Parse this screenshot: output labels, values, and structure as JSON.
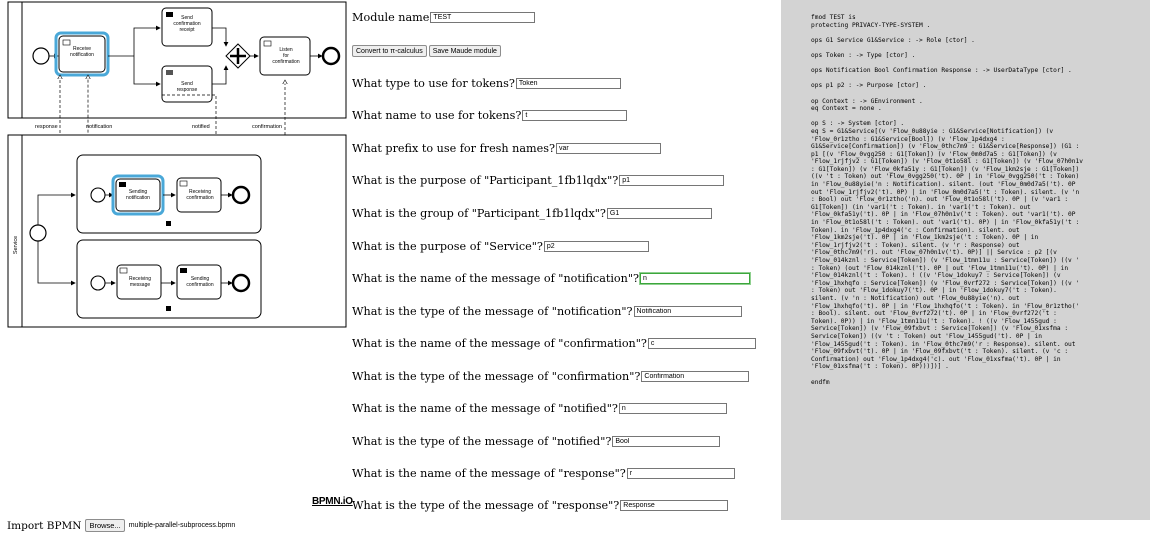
{
  "diagram": {
    "tasks": {
      "receive_notification": "Receive notification",
      "send_confirmation_receipt": "Send confirmation receipt",
      "send_response": "Send response",
      "listen_for_confirmation": "Listen for confirmation",
      "sending_notification": "Sending notification",
      "receiving_confirmation": "Receiving confirmation",
      "receiving_message": "Receiving message",
      "sending_confirmation": "Sending confirmation"
    },
    "lane_label": "Service",
    "edge_labels": {
      "response": "response",
      "notification": "notification",
      "notified": "notified",
      "confirmation": "confirmation"
    },
    "logo": "BPMN.iO"
  },
  "form": {
    "module_name_label": "Module name",
    "module_name_value": "TEST",
    "buttons": {
      "convert": "Convert to π-calculus",
      "save": "Save Maude module"
    },
    "fields": [
      {
        "label": "What type to use for tokens?",
        "value": "Token",
        "width": 105
      },
      {
        "label": "What name to use for tokens?",
        "value": "t",
        "width": 105
      },
      {
        "label": "What prefix to use for fresh names?",
        "value": "var",
        "width": 105
      },
      {
        "label": "What is the purpose of \"Participant_1fb1lqdx\"?",
        "value": "p1",
        "width": 105
      },
      {
        "label": "What is the group of \"Participant_1fb1lqdx\"?",
        "value": "G1",
        "width": 105
      },
      {
        "label": "What is the purpose of \"Service\"?",
        "value": "p2",
        "width": 105
      },
      {
        "label": "What is the name of the message of \"notification\"?",
        "value": "n",
        "width": 110,
        "focused": true
      },
      {
        "label": "What is the type of the message of \"notification\"?",
        "value": "Notification",
        "width": 108
      },
      {
        "label": "What is the name of the message of \"confirmation\"?",
        "value": "c",
        "width": 108
      },
      {
        "label": "What is the type of the message of \"confirmation\"?",
        "value": "Confirmation",
        "width": 108
      },
      {
        "label": "What is the name of the message of \"notified\"?",
        "value": "n",
        "width": 108
      },
      {
        "label": "What is the type of the message of \"notified\"?",
        "value": "Bool",
        "width": 108
      },
      {
        "label": "What is the name of the message of \"response\"?",
        "value": "r",
        "width": 108
      },
      {
        "label": "What is the type of the message of \"response\"?",
        "value": "Response",
        "width": 108
      }
    ]
  },
  "import": {
    "label": "Import BPMN",
    "browse": "Browse...",
    "filename": "multiple-parallel-subprocess.bpmn"
  },
  "code": {
    "text": "fmod TEST is\nprotecting PRIVACY-TYPE-SYSTEM .\n\nops G1 Service G1&Service : -> Role [ctor] .\n\nops Token : -> Type [ctor] .\n\nops Notification Bool Confirmation Response : -> UserDataType [ctor] .\n\nops p1 p2 : -> Purpose [ctor] .\n\nop Context : -> GEnvironment .\neq Context = none .\n\nop S : -> System [ctor] .\neq S = G1&Service[(v 'Flow_0u88yie : G1&Service[Notification]) (v\n'Flow_0r1ztho : G1&Service[Bool]) (v 'Flow_1p4dxg4 :\nG1&Service[Confirmation]) (v 'Flow_0thc7m9 : G1&Service[Response]) (G1 :\np1 [(v 'Flow_0vgg250 : G1[Token]) (v 'Flow_0m0d7a5 : G1[Token]) (v\n'Flow_1rjfjv2 : G1[Token]) (v 'Flow_0t1o58l : G1[Token]) (v 'Flow_07h0n1v\n: G1[Token]) (v 'Flow_0kfa51y : G1[Token]) (v 'Flow_1km2sje : G1[Token])\n((v 't : Token) out 'Flow_0vgg250('t). 0P | in 'Flow_0vgg250('t : Token)\nin 'Flow_0u88yie('n : Notification). silent. (out 'Flow_0m0d7a5('t). 0P\nout 'Flow_1rjfjv2('t). 0P) | in 'Flow_0m0d7a5('t : Token). silent. (v 'n\n: Bool) out 'Flow_0r1ztho('n). out 'Flow_0t1o58l('t). 0P | (v 'var1 :\nG1[Token]) (in 'var1('t : Token). in 'var1('t : Token). out\n'Flow_0kfa51y('t). 0P | in 'Flow_07h0n1v('t : Token). out 'var1('t). 0P\nin 'Flow_0t1o58l('t : Token). out 'var1('t). 0P) | in 'Flow_0kfa51y('t :\nToken). in 'Flow_1p4dxg4('c : Confirmation). silent. out\n'Flow_1km2sje('t). 0P | in 'Flow_1km2sje('t : Token). 0P | in\n'Flow_1rjfjv2('t : Token). silent. (v 'r : Response) out\n'Flow_0thc7m9('r). out 'Flow_07h0n1v('t). 0P)] || Service : p2 [(v\n'Flow_014kznl : Service[Token]) (v 'Flow_1tmn11u : Service[Token]) ((v '\n: Token) (out 'Flow_014kznl('t). 0P | out 'Flow_1tmn11u('t). 0P) | in\n'Flow_014kznl('t : Token). ! ((v 'Flow_1dokuy7 : Service[Token]) (v\n'Flow_1hxhqfo : Service[Token]) (v 'Flow_0vrf272 : Service[Token]) ((v '\n: Token) out 'Flow_1dokuy7('t). 0P | in 'Flow_1dokuy7('t : Token).\nsilent. (v 'n : Notification) out 'Flow_0u88yie('n). out\n'Flow_1hxhqfo('t). 0P | in 'Flow_1hxhqfo('t : Token). in 'Flow_0r1ztho('\n: Bool). silent. out 'Flow_0vrf272('t). 0P | in 'Flow_0vrf272('t :\nToken). 0P)) | in 'Flow_1tmn11u('t : Token). ! ((v 'Flow_1455gud :\nService[Token]) (v 'Flow_09fxbvt : Service[Token]) (v 'Flow_01xsfma :\nService[Token]) ((v 't : Token) out 'Flow_1455gud('t). 0P | in\n'Flow_1455gud('t : Token). in 'Flow_0thc7m9('r : Response). silent. out\n'Flow_09fxbvt('t). 0P | in 'Flow_09fxbvt('t : Token). silent. (v 'c :\nConfirmation) out 'Flow_1p4dxg4('c). out 'Flow_01xsfma('t). 0P | in\n'Flow_01xsfma('t : Token). 0P)))])] .\n\nendfm"
  }
}
